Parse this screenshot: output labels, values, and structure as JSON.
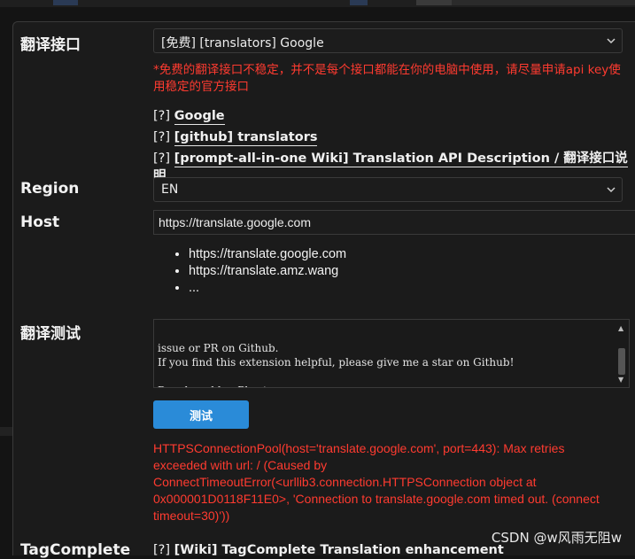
{
  "translator": {
    "label": "翻译接口",
    "selected": "[免费] [translators] Google",
    "warning": "*免费的翻译接口不稳定，并不是每个接口都能在你的电脑中使用，请尽量申请api key使用稳定的官方接口",
    "links": [
      {
        "prefix": "[?]",
        "text": "Google"
      },
      {
        "prefix": "[?]",
        "text": "[github] translators"
      },
      {
        "prefix": "[?]",
        "text": "[prompt-all-in-one Wiki] Translation API Description / 翻译接口说明"
      }
    ]
  },
  "region": {
    "label": "Region",
    "selected": "EN"
  },
  "host": {
    "label": "Host",
    "value": "https://translate.google.com",
    "options": [
      "https://translate.google.com",
      "https://translate.amz.wang",
      "..."
    ]
  },
  "test": {
    "label": "翻译测试",
    "text": "issue or PR on Github.\nIf you find this extension helpful, please give me a star on Github!\n\nDeveloped by: Physton\nGithub: Physton/sd-webui-prompt-all-in-one",
    "button": "测试",
    "error": "HTTPSConnectionPool(host='translate.google.com', port=443): Max retries exceeded with url: / (Caused by ConnectTimeoutError(<urllib3.connection.HTTPSConnection object at 0x000001D0118F11E0>, 'Connection to translate.google.com timed out. (connect timeout=30)'))"
  },
  "tagcomplete": {
    "label": "TagComplete",
    "link_prefix": "[?]",
    "link_text": "[Wiki] TagComplete Translation enhancement"
  },
  "watermark": "CSDN @w风雨无阻w",
  "colors": {
    "error": "#ff3b30",
    "accent": "#2a8bd8",
    "panel": "#1b1b1b"
  }
}
